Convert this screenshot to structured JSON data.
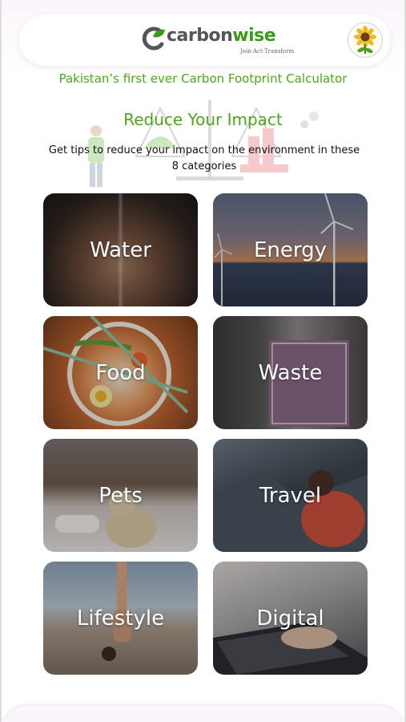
{
  "header": {
    "logo": {
      "part1": "carbon",
      "part2": "wise",
      "tagline": "Join·Act·Transform"
    },
    "avatar_icon": "sunflower-icon"
  },
  "banner": "Pakistan’s first ever Carbon Footprint Calculator",
  "section": {
    "title": "Reduce Your Impact",
    "subtitle": "Get tips to reduce your impact on the environment in these 8 categories"
  },
  "categories": [
    {
      "label": "Water"
    },
    {
      "label": "Energy"
    },
    {
      "label": "Food"
    },
    {
      "label": "Waste"
    },
    {
      "label": "Pets"
    },
    {
      "label": "Travel"
    },
    {
      "label": "Lifestyle"
    },
    {
      "label": "Digital"
    }
  ],
  "colors": {
    "brand_green": "#4fa51c",
    "logo_gray": "#555555"
  }
}
